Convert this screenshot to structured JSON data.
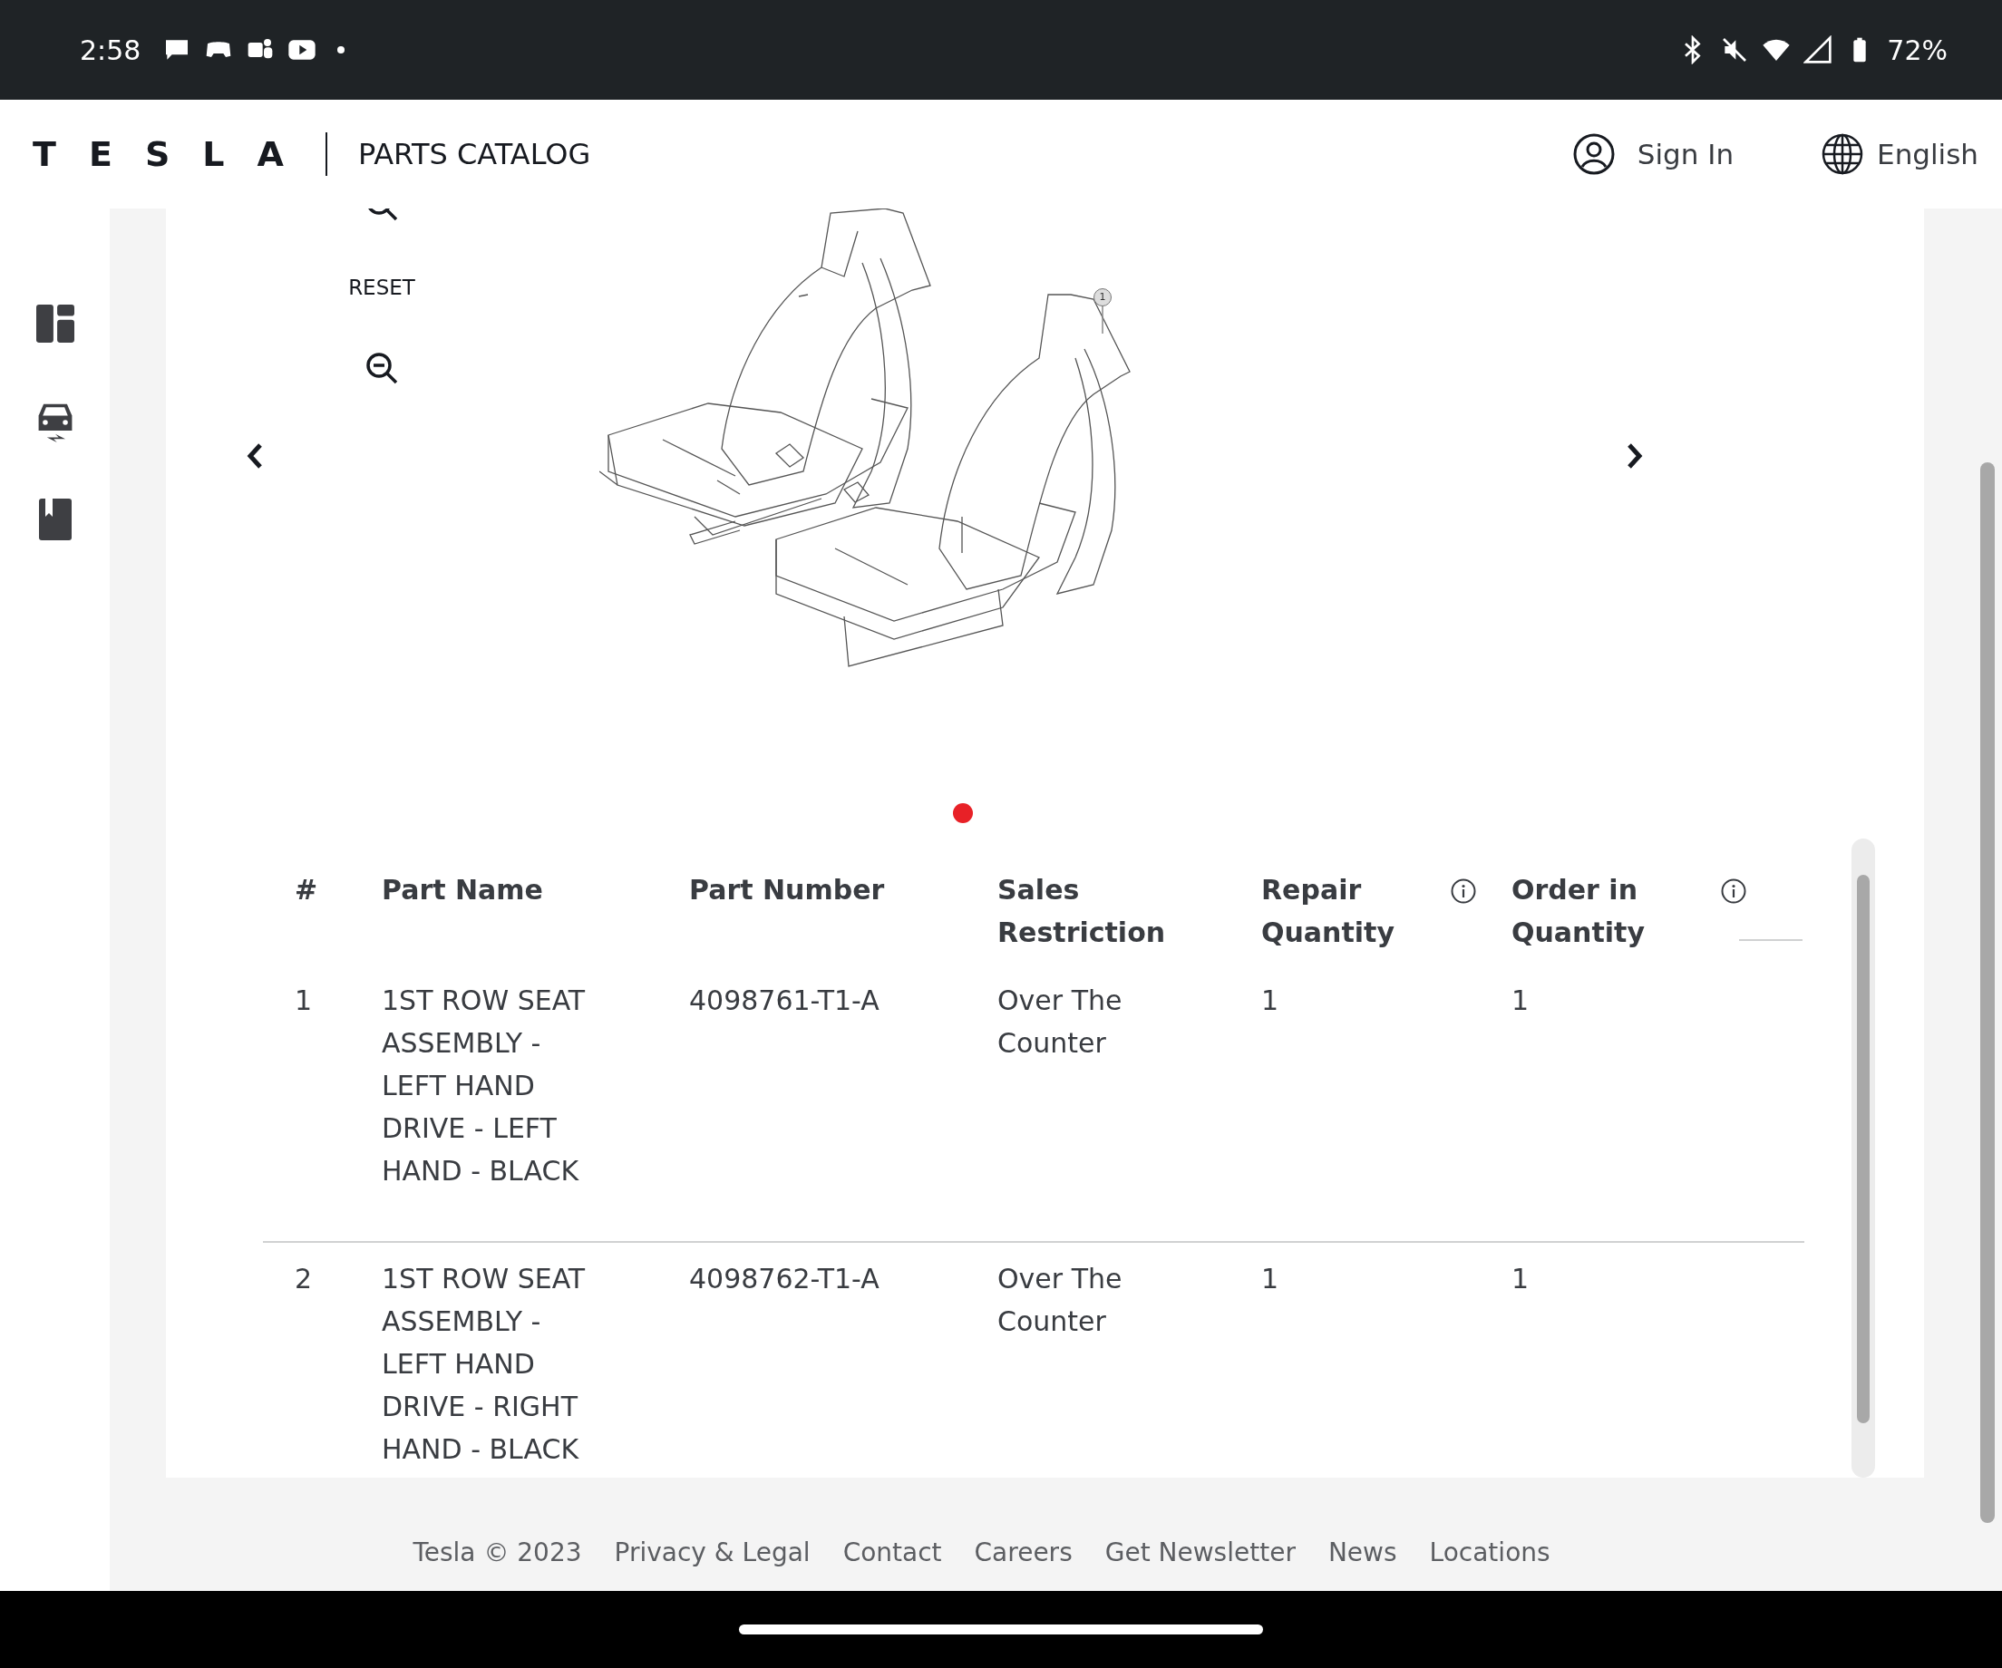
{
  "status_bar": {
    "time": "2:58",
    "battery": "72%"
  },
  "header": {
    "logo": "TESLA",
    "title": "PARTS CATALOG",
    "sign_in": "Sign In",
    "language": "English"
  },
  "viewer": {
    "reset": "RESET",
    "callouts": [
      "1"
    ],
    "slides": [
      {
        "selected": true
      }
    ]
  },
  "table": {
    "columns": [
      {
        "label": "#",
        "info": false
      },
      {
        "label": "Part Name",
        "info": false
      },
      {
        "label": "Part Number",
        "info": false
      },
      {
        "label": "Sales Restriction",
        "info": false
      },
      {
        "label": "Repair Quantity",
        "info": true
      },
      {
        "label": "Order in Quantity",
        "info": true
      }
    ],
    "rows": [
      {
        "cells": [
          "1",
          "1ST ROW SEAT ASSEMBLY - LEFT HAND DRIVE - LEFT HAND - BLACK",
          "4098761-T1-A",
          "Over The Counter",
          "1",
          "1"
        ]
      },
      {
        "cells": [
          "2",
          "1ST ROW SEAT ASSEMBLY - LEFT HAND DRIVE - RIGHT HAND - BLACK",
          "4098762-T1-A",
          "Over The Counter",
          "1",
          "1"
        ]
      }
    ]
  },
  "footer": {
    "links": [
      "Tesla © 2023",
      "Privacy & Legal",
      "Contact",
      "Careers",
      "Get Newsletter",
      "News",
      "Locations"
    ]
  }
}
